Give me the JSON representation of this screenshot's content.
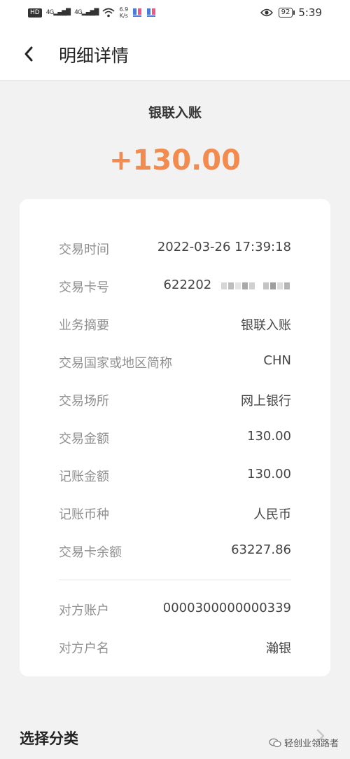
{
  "status_bar": {
    "badge": "HD",
    "signal1": "4G",
    "signal2": "4G",
    "speed": "6.9",
    "speed_unit": "K/s",
    "battery": "92",
    "time": "5:39"
  },
  "nav": {
    "title": "明细详情"
  },
  "summary": {
    "type_label": "银联入账",
    "amount": "+130.00",
    "amount_color": "#f28b4d"
  },
  "details": [
    {
      "label": "交易时间",
      "value": "2022-03-26 17:39:18"
    },
    {
      "label": "交易卡号",
      "value": "622202"
    },
    {
      "label": "业务摘要",
      "value": "银联入账"
    },
    {
      "label": "交易国家或地区简称",
      "value": "CHN"
    },
    {
      "label": "交易场所",
      "value": "网上银行"
    },
    {
      "label": "交易金额",
      "value": "130.00"
    },
    {
      "label": "记账金额",
      "value": "130.00"
    },
    {
      "label": "记账币种",
      "value": "人民币"
    },
    {
      "label": "交易卡余额",
      "value": "63227.86"
    }
  ],
  "counterparty": [
    {
      "label": "对方账户",
      "value": "0000300000000339"
    },
    {
      "label": "对方户名",
      "value": "瀚银"
    }
  ],
  "bottom": {
    "category_label": "选择分类",
    "watermark": "轻创业领路者"
  }
}
